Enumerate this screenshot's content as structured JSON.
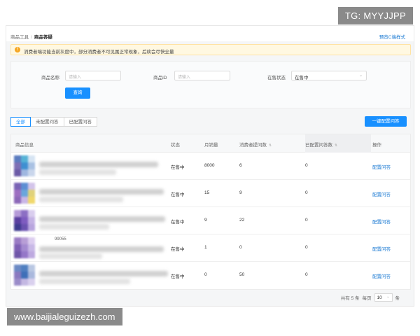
{
  "header": {
    "breadcrumb": [
      "商品工具",
      "商品答疑"
    ],
    "switch_link": "预览C端样式"
  },
  "notice": {
    "text": "消费者端功能当前灰度中，部分消费者不可见属正常现象，后续会尽快全量"
  },
  "filter": {
    "name_label": "商品名称",
    "name_placeholder": "请输入",
    "id_label": "商品ID",
    "id_placeholder": "请输入",
    "status_label": "在售状态",
    "status_value": "在售中",
    "query_button": "查询"
  },
  "tabs": [
    {
      "label": "全部",
      "active": true
    },
    {
      "label": "未配置问答",
      "active": false
    },
    {
      "label": "已配置问答",
      "active": false
    }
  ],
  "batch_button": "一键配置问答",
  "table": {
    "columns": [
      "商品信息",
      "状态",
      "月销量",
      "消费者提问数",
      "已配置问答数",
      "操作"
    ],
    "rows": [
      {
        "status": "在售中",
        "sales": "8000",
        "questions": "6",
        "answers": "0",
        "action": "配置问答",
        "code": ""
      },
      {
        "status": "在售中",
        "sales": "15",
        "questions": "9",
        "answers": "0",
        "action": "配置问答",
        "code": ""
      },
      {
        "status": "在售中",
        "sales": "9",
        "questions": "22",
        "answers": "0",
        "action": "配置问答",
        "code": ""
      },
      {
        "status": "在售中",
        "sales": "1",
        "questions": "0",
        "answers": "0",
        "action": "配置问答",
        "code": "99055"
      },
      {
        "status": "在售中",
        "sales": "0",
        "questions": "50",
        "answers": "0",
        "action": "配置问答",
        "code": ""
      }
    ]
  },
  "pagination": {
    "total": "共有 5 条",
    "per_page_label": "每页",
    "per_page": "10",
    "unit": "条"
  },
  "watermark": {
    "top": "TG: MYYJJPP",
    "bottom": "www.baijialeguizezh.com"
  },
  "colors": {
    "accent": "#1890ff",
    "notice_bg": "#fff8e1",
    "watermark_bg": "#8a8a8a"
  }
}
